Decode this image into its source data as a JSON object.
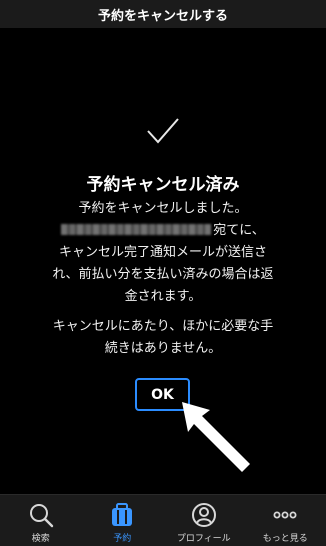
{
  "header": {
    "title": "予約をキャンセルする"
  },
  "dialog": {
    "title": "予約キャンセル済み",
    "message_line1": "予約をキャンセルしました。",
    "message_line2_suffix": "宛てに、",
    "message_line3": "キャンセル完了通知メールが送信さ",
    "message_line4": "れ、前払い分を支払い済みの場合は返",
    "message_line5": "金されます。",
    "note_line1": "キャンセルにあたり、ほかに必要な手",
    "note_line2": "続きはありません。",
    "ok_label": "OK"
  },
  "tabbar": {
    "items": [
      {
        "label": "検索",
        "icon": "search-icon"
      },
      {
        "label": "予約",
        "icon": "suitcase-icon",
        "active": true
      },
      {
        "label": "プロフィール",
        "icon": "profile-icon"
      },
      {
        "label": "もっと見る",
        "icon": "more-icon"
      }
    ]
  },
  "colors": {
    "accent": "#2b8cff",
    "background": "#000000",
    "bar": "#1b1b1b"
  }
}
